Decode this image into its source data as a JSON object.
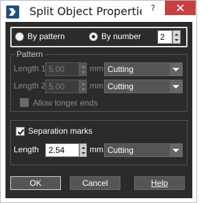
{
  "window": {
    "title": "Split Object Properties",
    "help_button": "?"
  },
  "mode": {
    "by_pattern_label": "By pattern",
    "by_number_label": "By number",
    "selected": "By number",
    "number_value": "2"
  },
  "pattern": {
    "title": "Pattern",
    "length1": {
      "label": "Length 1",
      "value": "5.00",
      "unit": "mm",
      "type": "Cutting"
    },
    "length2": {
      "label": "Length 2",
      "value": "5.00",
      "unit": "mm",
      "type": "Cutting"
    },
    "allow_longer_ends": {
      "label": "Allow longer ends",
      "checked": false,
      "enabled": false
    }
  },
  "separation": {
    "checkbox_label": "Separation marks",
    "checked": true,
    "length_label": "Length",
    "length_value": "2.54",
    "unit": "mm",
    "type": "Cutting"
  },
  "buttons": {
    "ok": "OK",
    "cancel": "Cancel",
    "help": "Help"
  },
  "colors": {
    "client_bg": "#2b2b2b",
    "close_red": "#c7403f",
    "control_grey": "#555555"
  }
}
